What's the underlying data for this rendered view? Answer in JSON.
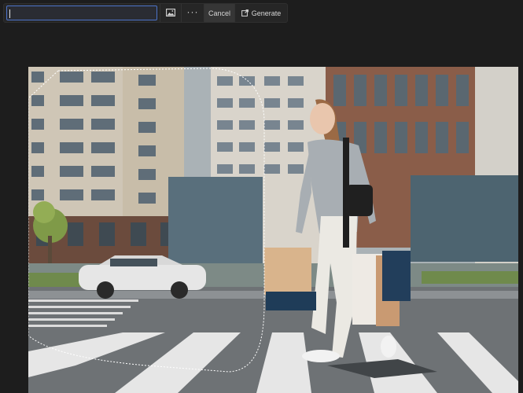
{
  "toolbar": {
    "prompt_value": "",
    "prompt_placeholder": "",
    "more_label": "···",
    "cancel_label": "Cancel",
    "generate_label": "Generate"
  },
  "canvas": {
    "selection": "lasso",
    "colors": {
      "background": "#1d1d1d",
      "toolbar": "#262626",
      "input_border": "#4c73c9"
    }
  }
}
